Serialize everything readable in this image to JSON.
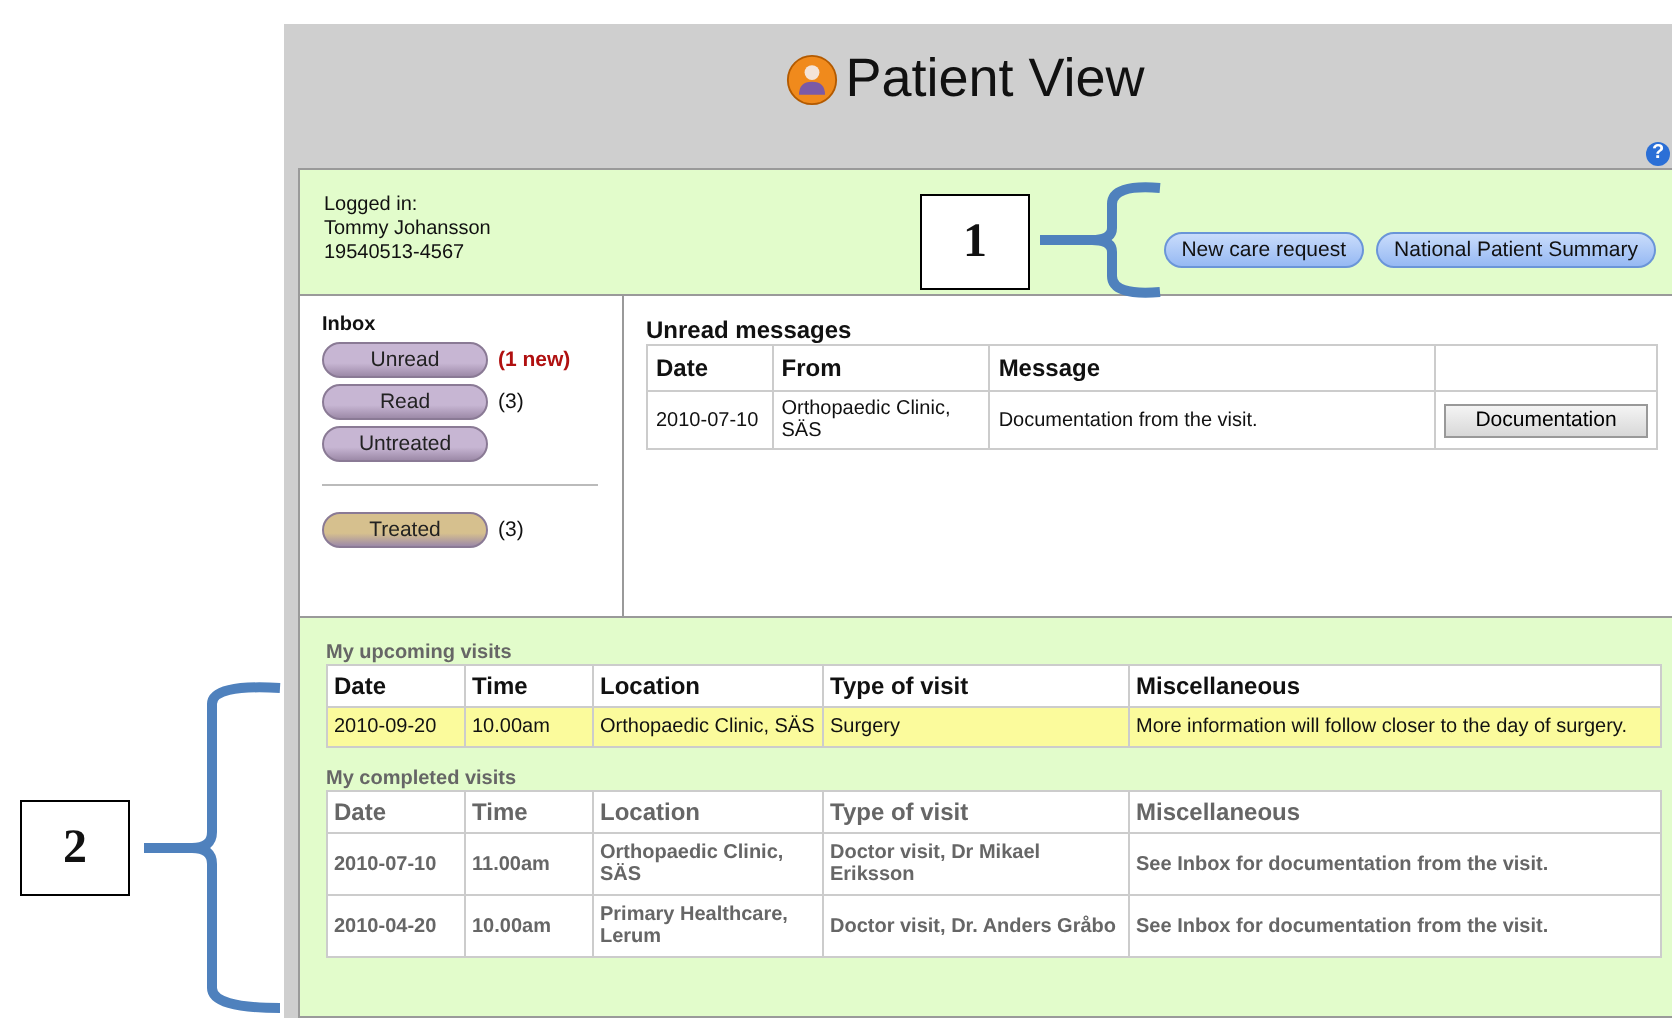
{
  "header": {
    "title": "Patient View",
    "help_icon": "?"
  },
  "user": {
    "label": "Logged in:",
    "name": "Tommy Johansson",
    "id": "19540513-4567"
  },
  "actions": [
    "New care request",
    "National Patient Summary"
  ],
  "inbox": {
    "title": "Inbox",
    "folder_groups": [
      [
        {
          "label": "Unread",
          "count": "(1 new)",
          "count_new": true,
          "color": "#c7b6d3"
        },
        {
          "label": "Read",
          "count": "(3)",
          "count_new": false,
          "color": "#c7b6d3"
        },
        {
          "label": "Untreated",
          "color": "#c7b6d3"
        }
      ],
      [
        {
          "label": "Treated",
          "count": "(3)",
          "count_new": false,
          "color": "#d6c08e"
        }
      ]
    ]
  },
  "messages": {
    "title": "Unread messages",
    "columns": [
      "Date",
      "From",
      "Message"
    ],
    "rows": [
      {
        "cells": [
          "2010-07-10",
          "Orthopaedic Clinic, SÄS",
          "Documentation from the visit."
        ],
        "action": "Documentation"
      }
    ]
  },
  "visit_tables": [
    {
      "title": "My upcoming visits",
      "kind": "upcoming",
      "columns": [
        "Date",
        "Time",
        "Location",
        "Type of visit",
        "Miscellaneous"
      ],
      "rows": [
        {
          "cells": [
            "2010-09-20",
            "10.00am",
            "Orthopaedic Clinic, SÄS",
            "Surgery",
            "More information will follow closer to the day of surgery."
          ],
          "highlighted": true
        }
      ]
    },
    {
      "title": "My completed visits",
      "kind": "completed",
      "columns": [
        "Date",
        "Time",
        "Location",
        "Type of visit",
        "Miscellaneous"
      ],
      "rows": [
        {
          "cells": [
            "2010-07-10",
            "11.00am",
            "Orthopaedic Clinic, SÄS",
            "Doctor visit, Dr Mikael Eriksson",
            "See Inbox for documentation from the visit."
          ],
          "highlighted": false
        },
        {
          "cells": [
            "2010-04-20",
            "10.00am",
            "Primary Healthcare, Lerum",
            "Doctor visit, Dr. Anders Gråbo",
            "See Inbox for documentation from the visit."
          ],
          "highlighted": false
        }
      ]
    }
  ],
  "annotations": [
    {
      "label": "1"
    },
    {
      "label": "2"
    }
  ]
}
